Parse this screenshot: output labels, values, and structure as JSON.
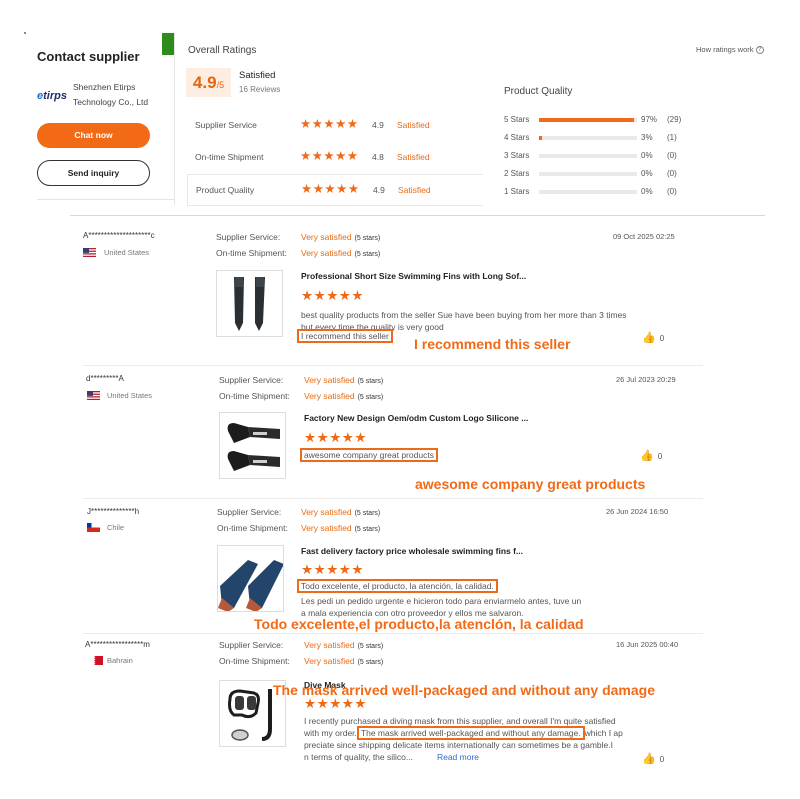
{
  "supplier": {
    "title": "Contact supplier",
    "logo_text_e": "e",
    "logo_text_rest": "tirps",
    "name_line1": "Shenzhen Etirps",
    "name_line2": "Technology Co., Ltd",
    "chat_label": "Chat now",
    "inquiry_label": "Send inquiry"
  },
  "overall": {
    "title": "Overall Ratings",
    "how_label": "How ratings work",
    "score": "4.9",
    "score_suffix": "/5",
    "status": "Satisfied",
    "reviews_count": "16 Reviews",
    "categories": [
      {
        "label": "Supplier Service",
        "stars": "★★★★★",
        "score": "4.9",
        "status": "Satisfied"
      },
      {
        "label": "On-time Shipment",
        "stars": "★★★★★",
        "score": "4.8",
        "status": "Satisfied"
      },
      {
        "label": "Product Quality",
        "stars": "★★★★★",
        "score": "4.9",
        "status": "Satisfied"
      }
    ]
  },
  "product_quality": {
    "title": "Product Quality",
    "distribution": [
      {
        "label": "5 Stars",
        "percent": 97,
        "percent_text": "97%",
        "count": "(29)"
      },
      {
        "label": "4 Stars",
        "percent": 3,
        "percent_text": "3%",
        "count": "(1)"
      },
      {
        "label": "3 Stars",
        "percent": 0,
        "percent_text": "0%",
        "count": "(0)"
      },
      {
        "label": "2 Stars",
        "percent": 0,
        "percent_text": "0%",
        "count": "(0)"
      },
      {
        "label": "1 Stars",
        "percent": 0,
        "percent_text": "0%",
        "count": "(0)"
      }
    ]
  },
  "reviews": [
    {
      "user": "A********************c",
      "country": "United States",
      "service_key": "Supplier Service:",
      "service_val": "Very satisfied",
      "service_stars": "(5 stars)",
      "ship_key": "On-time Shipment:",
      "ship_val": "Very satisfied",
      "ship_stars": "(5 stars)",
      "date": "09 Oct 2025 02:25",
      "product": "Professional Short Size Swimming Fins with Long Sof...",
      "stars": "★★★★★",
      "text": "best quality products from the seller Sue  have been buying from her more than 3 times but every time the quality is very good",
      "highlight": "I recommend this seller",
      "likes": "0",
      "overlay": "I recommend this seller"
    },
    {
      "user": "d*********A",
      "country": "United States",
      "service_key": "Supplier Service:",
      "service_val": "Very satisfied",
      "service_stars": "(5 stars)",
      "ship_key": "On-time Shipment:",
      "ship_val": "Very satisfied",
      "ship_stars": "(5 stars)",
      "date": "26 Jul 2023 20:29",
      "product": "Factory New Design Oem/odm Custom Logo Silicone ...",
      "stars": "★★★★★",
      "highlight": "awesome company great products",
      "likes": "0",
      "overlay": "awesome company great products"
    },
    {
      "user": "J**************h",
      "country": "Chile",
      "service_key": "Supplier Service:",
      "service_val": "Very satisfied",
      "service_stars": "(5 stars)",
      "ship_key": "On-time Shipment:",
      "ship_val": "Very satisfied",
      "ship_stars": "(5 stars)",
      "date": "26 Jun 2024 16:50",
      "product": "Fast delivery factory price wholesale swimming fins f...",
      "stars": "★★★★★",
      "highlight": "Todo excelente, el producto, la atención, la calidad.",
      "text_line1": "Les pedi un pedido urgente e hicieron todo para enviarmelo antes, tuve un",
      "text_line2": "a mala experiencia con otro proveedor y ellos me salvaron.",
      "overlay": "Todo excelente,el producto,la atenclón, la calidad"
    },
    {
      "user": "A*****************m",
      "country": "Bahrain",
      "service_key": "Supplier Service:",
      "service_val": "Very satisfied",
      "service_stars": "(5 stars)",
      "ship_key": "On-time Shipment:",
      "ship_val": "Very satisfied",
      "ship_stars": "(5 stars)",
      "date": "16 Jun 2025 00:40",
      "product": "Dive Mask",
      "stars": "★★★★★",
      "text_line1": "I recently purchased a diving mask from this supplier, and overall I'm quite satisfied",
      "text_pre": "with my order.",
      "highlight": "The mask arrived well-packaged and without any damage.",
      "text_post": "which I ap",
      "text_line3": "preciate since shipping delicate items internationally can sometimes be a gamble.I",
      "text_line4": "n terms of quality, the silico...",
      "read_more": "Read more",
      "likes": "0",
      "overlay": "The mask arrived well-packaged and without any damage"
    }
  ]
}
